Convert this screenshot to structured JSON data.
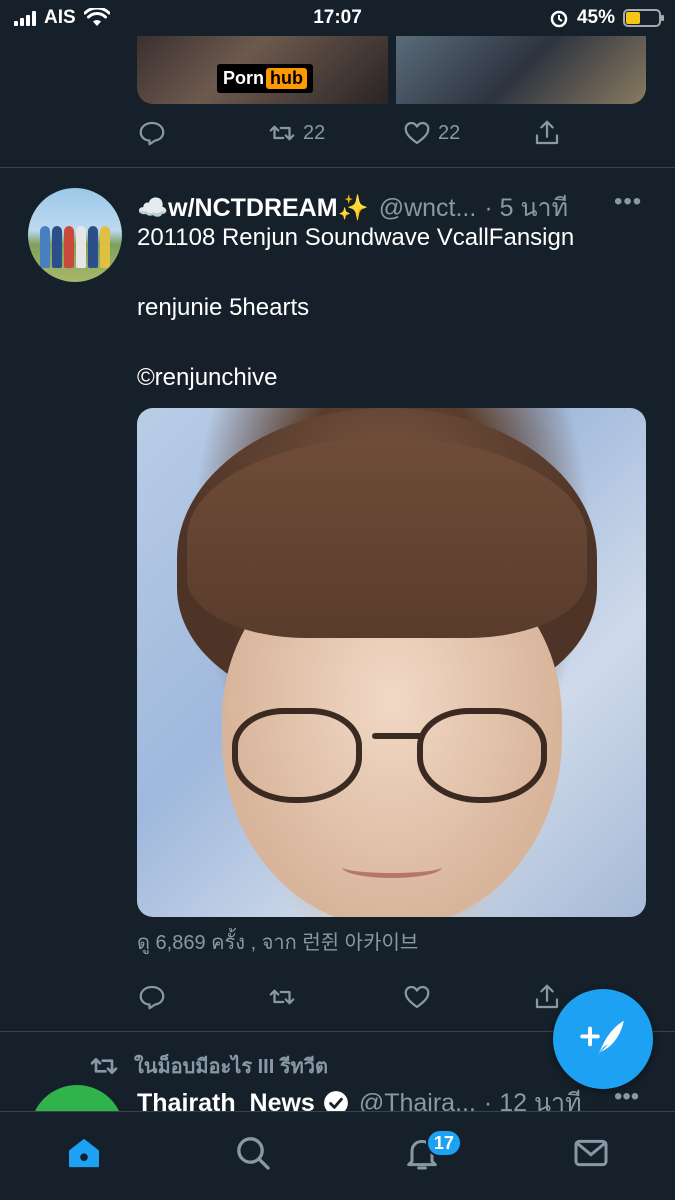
{
  "status": {
    "carrier": "AIS",
    "time": "17:07",
    "battery_pct": "45%",
    "battery_level": 0.45
  },
  "prev_tweet": {
    "media_logo_left": "Porn",
    "media_logo_right": "hub",
    "retweets": "22",
    "likes": "22"
  },
  "tweet": {
    "name": "☁️w/NCTDREAM✨",
    "handle": "@wnct...",
    "time": "· 5 นาที",
    "line1": "201108 Renjun Soundwave VcallFansign",
    "line2": "renjunie 5hearts",
    "line3": "©renjunchive",
    "views": "ดู 6,869 ครั้ง , จาก 런쥔 아카이브"
  },
  "next": {
    "retweet_label": "ในม็อบมีอะไร III รีทวีต",
    "name": "Thairath_News",
    "handle": "@Thaira...",
    "time": "· 12 นาที"
  },
  "tabbar": {
    "notifications_count": "17"
  },
  "more_glyph": "•••"
}
